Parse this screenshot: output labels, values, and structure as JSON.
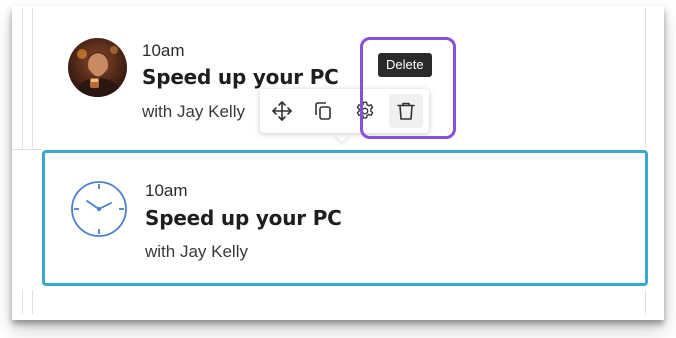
{
  "events": [
    {
      "time": "10am",
      "title": "Speed up your PC",
      "host": "with Jay Kelly",
      "icon": "avatar-photo"
    },
    {
      "time": "10am",
      "title": "Speed up your PC",
      "host": "with Jay Kelly",
      "icon": "clock-icon"
    }
  ],
  "toolbar": {
    "tools": [
      {
        "name": "move",
        "icon": "move-arrows-icon"
      },
      {
        "name": "duplicate",
        "icon": "copy-icon"
      },
      {
        "name": "settings",
        "icon": "gear-icon"
      },
      {
        "name": "delete",
        "icon": "trash-icon"
      }
    ],
    "tooltip": "Delete"
  },
  "colors": {
    "selected_border": "#3aa8cc",
    "callout_border": "#8a4fd8",
    "clock_stroke": "#4a7fd4",
    "tooltip_bg": "#2a2a2a"
  }
}
